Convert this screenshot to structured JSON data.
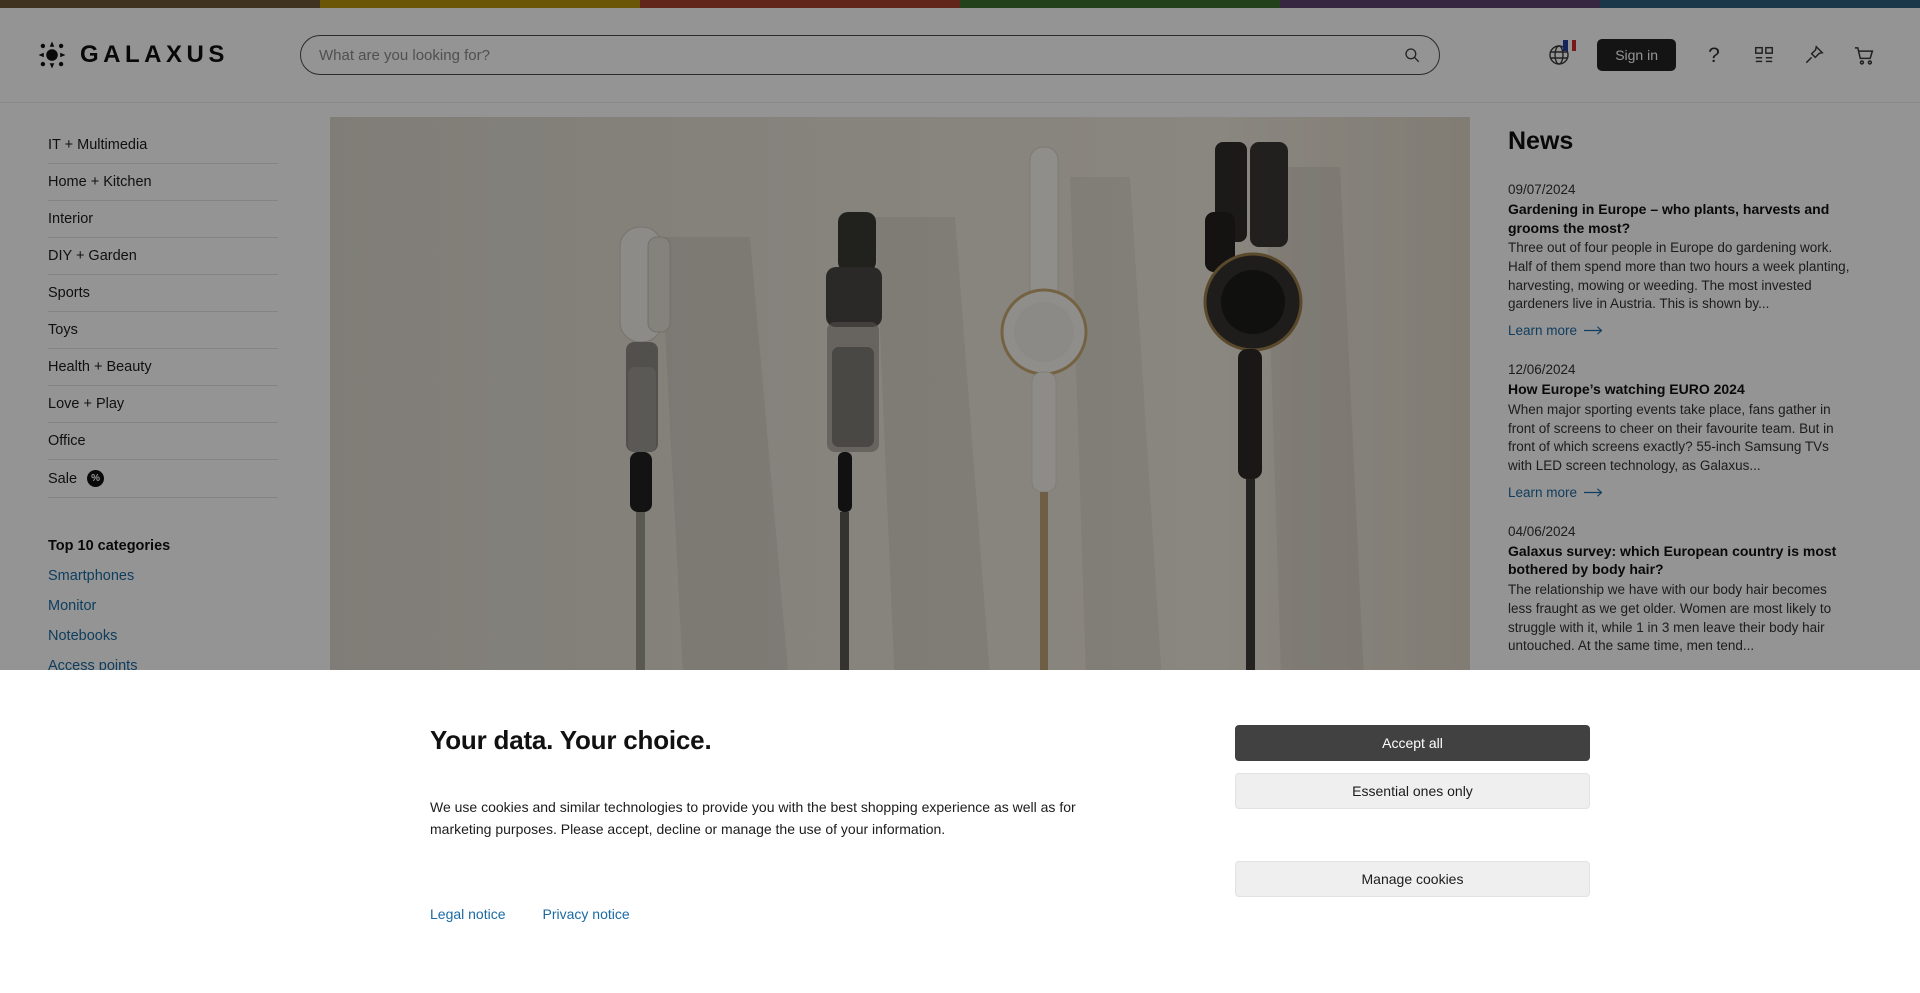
{
  "brand": {
    "name": "GALAXUS",
    "logo_icon": "sun-logo-icon"
  },
  "colorbar": [
    "#6e5a3a",
    "#b8940f",
    "#a8432c",
    "#3d7030",
    "#5e4373",
    "#2e6080"
  ],
  "search": {
    "placeholder": "What are you looking for?",
    "value": "",
    "icon": "search-icon"
  },
  "header": {
    "language_icon": "globe-icon",
    "flag": {
      "name": "france-flag",
      "colors": [
        "#2341a0",
        "#ffffff",
        "#d1282e"
      ]
    },
    "sign_in_label": "Sign in",
    "help_icon": "question-mark-icon",
    "compare_icon": "grid-list-icon",
    "pin_icon": "pin-icon",
    "cart_icon": "shopping-cart-icon"
  },
  "sidebar": {
    "categories": [
      {
        "label": "IT + Multimedia"
      },
      {
        "label": "Home + Kitchen"
      },
      {
        "label": "Interior"
      },
      {
        "label": "DIY + Garden"
      },
      {
        "label": "Sports"
      },
      {
        "label": "Toys"
      },
      {
        "label": "Health + Beauty"
      },
      {
        "label": "Love + Play"
      },
      {
        "label": "Office"
      },
      {
        "label": "Sale",
        "badge": "%"
      }
    ],
    "top10": {
      "title": "Top 10 categories",
      "items": [
        {
          "label": "Smartphones"
        },
        {
          "label": "Monitor"
        },
        {
          "label": "Notebooks"
        },
        {
          "label": "Access points"
        }
      ]
    },
    "link_color": "#1a6aa3"
  },
  "hero": {
    "alt": "Four cordless stick vacuum cleaners standing against a white wall on a tiled floor"
  },
  "news": {
    "title": "News",
    "learn_more_label": "Learn more",
    "items": [
      {
        "date": "09/07/2024",
        "title": "Gardening in Europe – who plants, harvests and grooms the most?",
        "body": "Three out of four people in Europe do gardening work. Half of them spend more than two hours a week planting, harvesting, mowing or weeding. The most invested gardeners live in Austria. This is shown by..."
      },
      {
        "date": "12/06/2024",
        "title": "How Europe’s watching EURO 2024",
        "body": "When major sporting events take place, fans gather in front of screens to cheer on their favourite team. But in front of which screens exactly? 55-inch Samsung TVs with LED screen technology, as Galaxus..."
      },
      {
        "date": "04/06/2024",
        "title": "Galaxus survey: which European country is most bothered by body hair?",
        "body": "The relationship we have with our body hair becomes less fraught as we get older. Women are most likely to struggle with it, while 1 in 3 men leave their body hair untouched. At the same time, men tend..."
      }
    ]
  },
  "cookie_banner": {
    "title": "Your data. Your choice.",
    "text": "We use cookies and similar technologies to provide you with the best shopping experience as well as for marketing purposes. Please accept, decline or manage the use of your information.",
    "accept_all": "Accept all",
    "essential_only": "Essential ones only",
    "manage": "Manage cookies",
    "legal_notice": "Legal notice",
    "privacy_notice": "Privacy notice"
  }
}
